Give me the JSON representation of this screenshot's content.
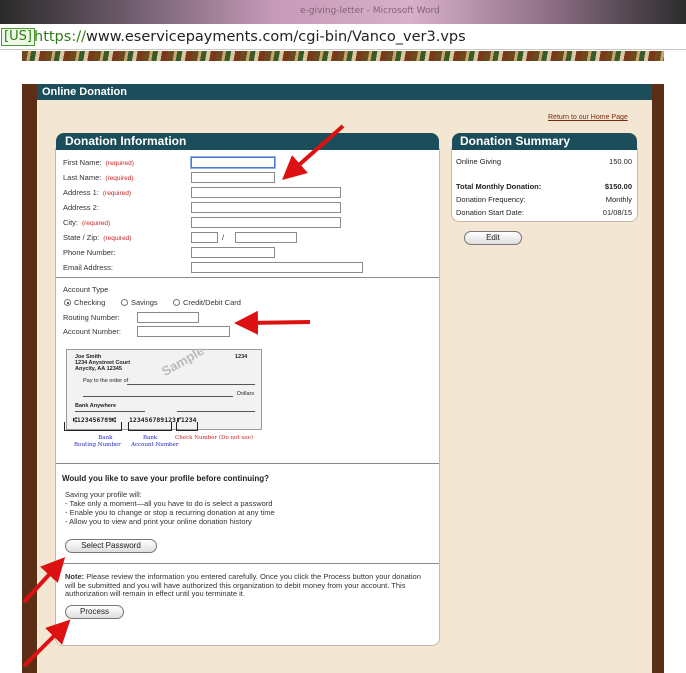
{
  "browser": {
    "window_title": "e-giving-letter - Microsoft Word",
    "cert_label": "[US]",
    "url_scheme": "https://",
    "url_rest": "www.eservicepayments.com/cgi-bin/Vanco_ver3.vps"
  },
  "page": {
    "header": "Online Donation",
    "home_link": "Return to our Home Page"
  },
  "donation_info": {
    "title": "Donation Information",
    "required_text": "(required)",
    "fields": {
      "first_name": "First Name:",
      "last_name": "Last Name:",
      "address1": "Address 1:",
      "address2": "Address 2:",
      "city": "City:",
      "state_zip": "State / Zip:",
      "phone": "Phone Number:",
      "email": "Email Address:"
    },
    "zip_separator": "/",
    "account_type_label": "Account Type",
    "account_options": [
      "Checking",
      "Savings",
      "Credit/Debit Card"
    ],
    "selected_account": "Checking",
    "routing_label": "Routing Number:",
    "account_label": "Account Number:"
  },
  "check": {
    "name": "Joe Smith",
    "street": "1234 Anystreet Court",
    "city": "Anycity, AA 12345",
    "number": "1234",
    "pay_to": "Pay to the order of",
    "dollars": "Dollars",
    "bank": "Bank Anywhere",
    "sample": "Sample",
    "micr_routing": "⑆123456789⑆",
    "micr_account": "123456789123",
    "micr_check": "⑈1234",
    "label_routing_1": "Bank",
    "label_routing_2": "Routing Number",
    "label_account_1": "Bank",
    "label_account_2": "Account Number",
    "label_check": "Check Number (Do not use)"
  },
  "profile": {
    "question": "Would you like to save your profile before continuing?",
    "intro": "Saving your profile will:",
    "bullets": [
      "- Take only a moment—all you have to do is select a password",
      "- Enable you to change or stop a recurring donation at any time",
      "- Allow you to view and print your online donation history"
    ],
    "button": "Select Password"
  },
  "note": {
    "label": "Note:",
    "text": "Please review the information you entered carefully. Once you click the Process button your donation will be submitted and you will have authorized this organization to debit money from your account. This authorization will remain in effect until you terminate it.",
    "button": "Process"
  },
  "summary": {
    "title": "Donation Summary",
    "line_label": "Online Giving",
    "line_value": "150.00",
    "total_label": "Total Monthly Donation:",
    "total_value": "$150.00",
    "freq_label": "Donation Frequency:",
    "freq_value": "Monthly",
    "start_label": "Donation Start Date:",
    "start_value": "01/08/15",
    "edit_button": "Edit"
  },
  "colors": {
    "header_teal": "#1b4e5a",
    "frame_brown": "#5a2f16",
    "content_beige": "#f3e6d2",
    "required_red": "#cc2222",
    "arrow_red": "#dd1111",
    "label_blue": "#1a1acc"
  }
}
